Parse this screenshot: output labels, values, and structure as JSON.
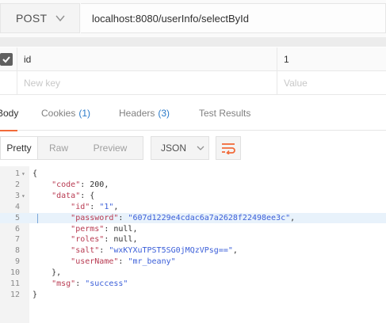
{
  "request": {
    "method": "POST",
    "url": "localhost:8080/userInfo/selectById"
  },
  "params": [
    {
      "key": "id",
      "value": "1",
      "checked": true
    },
    {
      "key_placeholder": "New key",
      "value_placeholder": "Value"
    }
  ],
  "tabs": {
    "body": "Body",
    "cookies": "Cookies",
    "cookies_count": "(1)",
    "headers": "Headers",
    "headers_count": "(3)",
    "tests": "Test Results"
  },
  "format": {
    "pretty": "Pretty",
    "raw": "Raw",
    "preview": "Preview",
    "language": "JSON"
  },
  "code_lines": [
    {
      "n": "1",
      "fold": "▾",
      "code": "{"
    },
    {
      "n": "2",
      "fold": "",
      "indent": "    ",
      "key": "\"code\"",
      "sep": ": ",
      "val": "200,",
      "valtype": "plain"
    },
    {
      "n": "3",
      "fold": "▾",
      "indent": "    ",
      "key": "\"data\"",
      "sep": ": ",
      "val": "{",
      "valtype": "plain"
    },
    {
      "n": "4",
      "fold": "",
      "indent": "        ",
      "key": "\"id\"",
      "sep": ": ",
      "val": "\"1\"",
      "after": ",",
      "valtype": "string"
    },
    {
      "n": "5",
      "fold": "",
      "indent": "        ",
      "key": "\"password\"",
      "sep": ": ",
      "val": "\"607d1229e4cdac6a7a2628f22498ee3c\"",
      "after": ",",
      "valtype": "string",
      "active": true
    },
    {
      "n": "6",
      "fold": "",
      "indent": "        ",
      "key": "\"perms\"",
      "sep": ": ",
      "val": "null,",
      "valtype": "plain"
    },
    {
      "n": "7",
      "fold": "",
      "indent": "        ",
      "key": "\"roles\"",
      "sep": ": ",
      "val": "null,",
      "valtype": "plain"
    },
    {
      "n": "8",
      "fold": "",
      "indent": "        ",
      "key": "\"salt\"",
      "sep": ": ",
      "val": "\"wxKYXuTPST5SG0jMQzVPsg==\"",
      "after": ",",
      "valtype": "string"
    },
    {
      "n": "9",
      "fold": "",
      "indent": "        ",
      "key": "\"userName\"",
      "sep": ": ",
      "val": "\"mr_beany\"",
      "valtype": "string"
    },
    {
      "n": "10",
      "fold": "",
      "code": "    },"
    },
    {
      "n": "11",
      "fold": "",
      "indent": "    ",
      "key": "\"msg\"",
      "sep": ": ",
      "val": "\"success\"",
      "valtype": "string"
    },
    {
      "n": "12",
      "fold": "",
      "code": "}"
    }
  ],
  "colors": {
    "accent": "#f26b3a",
    "link_blue": "#2a7ac9",
    "json_key": "#b83b52",
    "json_string": "#3b5fd9"
  }
}
